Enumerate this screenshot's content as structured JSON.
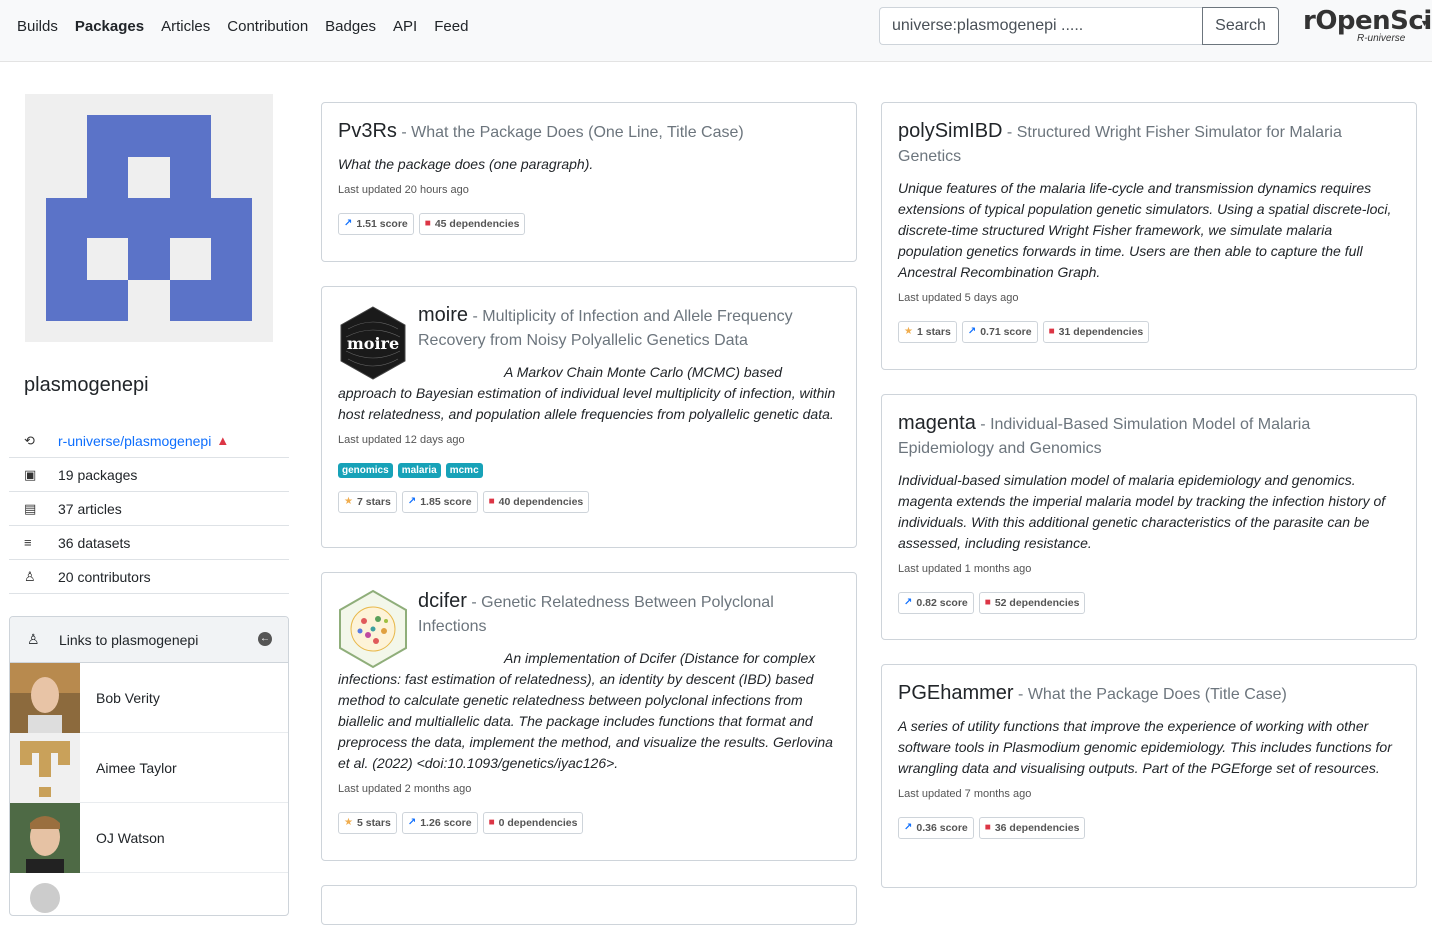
{
  "nav": {
    "links": [
      "Builds",
      "Packages",
      "Articles",
      "Contribution",
      "Badges",
      "API",
      "Feed"
    ],
    "active": "Packages",
    "search_value": "universe:plasmogenepi .....",
    "search_button": "Search",
    "brand": "rOpenSci",
    "brand_sub": "R-universe"
  },
  "sidebar": {
    "org": "plasmogenepi",
    "repo_link": "r-universe/plasmogenepi",
    "stats": {
      "packages": "19 packages",
      "articles": "37 articles",
      "datasets": "36 datasets",
      "contributors": "20 contributors"
    },
    "links_title": "Links to plasmogenepi",
    "contributors": [
      "Bob Verity",
      "Aimee Taylor",
      "OJ Watson"
    ]
  },
  "packages": [
    {
      "name": "Pv3Rs",
      "title": "What the Package Does (One Line, Title Case)",
      "description": "What the package does (one paragraph).",
      "updated": "Last updated 20 hours ago",
      "badges": [
        {
          "kind": "score",
          "text": "1.51 score"
        },
        {
          "kind": "dep",
          "text": "45 dependencies"
        }
      ]
    },
    {
      "name": "moire",
      "title": "Multiplicity of Infection and Allele Frequency Recovery from Noisy Polyallelic Genetics Data",
      "description": "A Markov Chain Monte Carlo (MCMC) based approach to Bayesian estimation of individual level multiplicity of infection, within host relatedness, and population allele frequencies from polyallelic genetic data.",
      "updated": "Last updated 12 days ago",
      "topics": [
        "genomics",
        "malaria",
        "mcmc"
      ],
      "logo_text": "moire",
      "badges": [
        {
          "kind": "star",
          "text": "7 stars"
        },
        {
          "kind": "score",
          "text": "1.85 score"
        },
        {
          "kind": "dep",
          "text": "40 dependencies"
        }
      ]
    },
    {
      "name": "dcifer",
      "title": "Genetic Relatedness Between Polyclonal Infections",
      "description": "An implementation of Dcifer (Distance for complex infections: fast estimation of relatedness), an identity by descent (IBD) based method to calculate genetic relatedness between polyclonal infections from biallelic and multiallelic data. The package includes functions that format and preprocess the data, implement the method, and visualize the results. Gerlovina et al. (2022) <doi:10.1093/genetics/iyac126>.",
      "updated": "Last updated 2 months ago",
      "badges": [
        {
          "kind": "star",
          "text": "5 stars"
        },
        {
          "kind": "score",
          "text": "1.26 score"
        },
        {
          "kind": "dep",
          "text": "0 dependencies"
        }
      ]
    },
    {
      "name": "polySimIBD",
      "title": "Structured Wright Fisher Simulator for Malaria Genetics",
      "description": "Unique features of the malaria life-cycle and transmission dynamics requires extensions of typical population genetic simulators. Using a spatial discrete-loci, discrete-time structured Wright Fisher framework, we simulate malaria population genetics forwards in time. Users are then able to capture the full Ancestral Recombination Graph.",
      "updated": "Last updated 5 days ago",
      "badges": [
        {
          "kind": "star",
          "text": "1 stars"
        },
        {
          "kind": "score",
          "text": "0.71 score"
        },
        {
          "kind": "dep",
          "text": "31 dependencies"
        }
      ]
    },
    {
      "name": "magenta",
      "title": "Individual-Based Simulation Model of Malaria Epidemiology and Genomics",
      "description": "Individual-based simulation model of malaria epidemiology and genomics. magenta extends the imperial malaria model by tracking the infection history of individuals. With this additional genetic characteristics of the parasite can be assessed, including resistance.",
      "updated": "Last updated 1 months ago",
      "badges": [
        {
          "kind": "score",
          "text": "0.82 score"
        },
        {
          "kind": "dep",
          "text": "52 dependencies"
        }
      ]
    },
    {
      "name": "PGEhammer",
      "title": "What the Package Does (Title Case)",
      "description": "A series of utility functions that improve the experience of working with other software tools in Plasmodium genomic epidemiology. This includes functions for wrangling data and visualising outputs. Part of the PGEforge set of resources.",
      "updated": "Last updated 7 months ago",
      "badges": [
        {
          "kind": "score",
          "text": "0.36 score"
        },
        {
          "kind": "dep",
          "text": "36 dependencies"
        }
      ]
    }
  ],
  "colors": {
    "identicon": "#5b73c8",
    "link": "#0d6efd",
    "topic": "#17a2b8"
  }
}
